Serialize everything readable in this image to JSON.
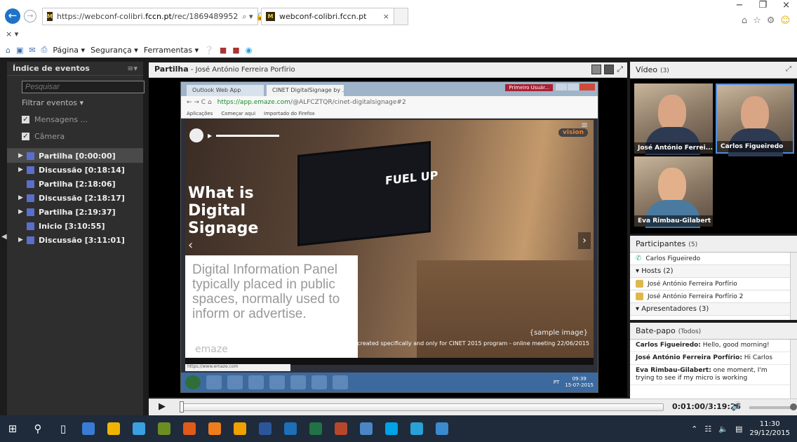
{
  "browser": {
    "url_prefix": "https://webconf-colibri.",
    "url_domain": "fccn.pt",
    "url_path": "/rec/1869489952",
    "addr_tools": "⌕ ▾ 🔒 ↻",
    "tab_title": "webconf-colibri.fccn.pt",
    "tab_close": "×",
    "row2": "× ▾",
    "menu": {
      "pagina": "Página ▾",
      "seguranca": "Segurança ▾",
      "ferramentas": "Ferramentas ▾"
    },
    "win": {
      "minimize": "−",
      "restore": "❐",
      "close": "×"
    }
  },
  "events": {
    "title": "Índice de eventos",
    "menu_glyph": "≡▾",
    "search_placeholder": "Pesquisar",
    "filter": "Filtrar eventos ▾",
    "checks": [
      "Mensagens ...",
      "Câmera"
    ],
    "items": [
      {
        "label": "Partilha [0:00:00]",
        "expand": "▶",
        "selected": true
      },
      {
        "label": "Discussão [0:18:14]",
        "expand": "▶",
        "selected": false
      },
      {
        "label": "Partilha [2:18:06]",
        "expand": "",
        "selected": false
      },
      {
        "label": "Discussão [2:18:17]",
        "expand": "▶",
        "selected": false
      },
      {
        "label": "Partilha [2:19:37]",
        "expand": "▶",
        "selected": false
      },
      {
        "label": "Inicio [3:10:55]",
        "expand": "",
        "selected": false
      },
      {
        "label": "Discussão [3:11:01]",
        "expand": "▶",
        "selected": false
      }
    ]
  },
  "share": {
    "title": "Partilha",
    "subtitle": " - José  António Ferreira Porfírio",
    "screen": {
      "tab1": "Outlook Web App",
      "tab2": "CINET DigitalSignage by ...",
      "user": "Primeiro Usuár...",
      "url_main": "https://app.emaze.com",
      "url_rest": "/@ALFCZTQR/cinet-digitalsignage#2",
      "bookmarks": [
        "Aplicações",
        "Começar aqui",
        "Importado do Firefox"
      ],
      "vision": "vision",
      "headline": "What is Digital Signage",
      "panel_text": "Digital Information Panel typically placed in public spaces, normally used to inform or advertise.",
      "logo": "emaze",
      "fuel": "FUEL UP",
      "sample": "{sample image}",
      "caption": "created specifically and only for CINET 2015 program - online meeting 22/06/2015",
      "status_url": "https://www.emaze.com",
      "lang": "PT",
      "clock_time": "09:39",
      "clock_date": "15-07-2015"
    }
  },
  "playback": {
    "play": "▶",
    "time": "0:01:00/3:19:25",
    "volume_icon": "🔊"
  },
  "video": {
    "title": "Vídeo",
    "count": "(3)",
    "max": "⤢",
    "feeds": [
      {
        "name": "José  António Ferrei..."
      },
      {
        "name": "Carlos Figueiredo"
      },
      {
        "name": "Eva Rimbau-Gilabert"
      }
    ]
  },
  "participants": {
    "title": "Participantes",
    "count": "(5)",
    "phone_user": "Carlos Figueiredo",
    "hosts_label": "▾ Hosts (2)",
    "hosts": [
      "José  António Ferreira Porfírio",
      "José  António Ferreira Porfírio 2"
    ],
    "presenters_label": "▾ Apresentadores (3)"
  },
  "chat": {
    "title": "Bate-papo",
    "scope": "(Todos)",
    "messages": [
      {
        "author": "Carlos Figueiredo:",
        "text": " Hello, good morning!"
      },
      {
        "author": "José  António Ferreira Porfírio:",
        "text": " Hi Carlos"
      },
      {
        "author": "Eva Rimbau-Gilabert:",
        "text": " one moment, I'm trying to see if my micro is working"
      }
    ]
  },
  "taskbar": {
    "time": "11:30",
    "date": "29/12/2015",
    "colors": [
      "#3a7bd5",
      "#f0b400",
      "#3aa0e0",
      "#6b8e23",
      "#e05a1a",
      "#ef7d1a",
      "#f0a000",
      "#2b579a",
      "#1d6fb8",
      "#217346",
      "#b7472a",
      "#4a86c5",
      "#00a2e8",
      "#2aa0d8",
      "#3a8ad0"
    ]
  }
}
